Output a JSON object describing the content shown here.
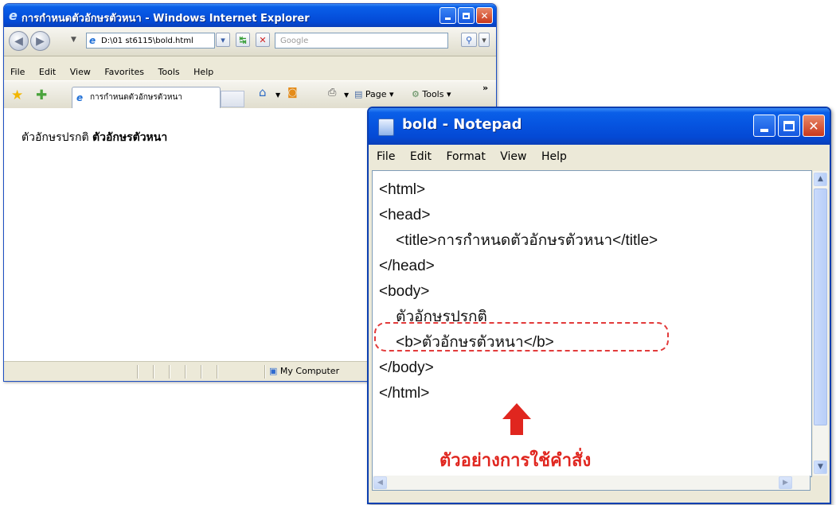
{
  "ie": {
    "title": "การกำหนดตัวอักษรตัวหนา - Windows Internet Explorer",
    "address": "D:\\01 st6115\\bold.html",
    "search_placeholder": "Google",
    "menu": [
      "File",
      "Edit",
      "View",
      "Favorites",
      "Tools",
      "Help"
    ],
    "tab_label": "การกำหนดตัวอักษรตัวหนา",
    "toolbar": {
      "page_label": "Page",
      "tools_label": "Tools"
    },
    "content": {
      "normal_text": "ตัวอักษรปรกติ",
      "bold_text": "ตัวอักษรตัวหนา"
    },
    "status_zone": "My Computer"
  },
  "notepad": {
    "title": "bold - Notepad",
    "menu": [
      "File",
      "Edit",
      "Format",
      "View",
      "Help"
    ],
    "code_lines": [
      "<html>",
      "<head>",
      "    <title>การกำหนดตัวอักษรตัวหนา</title>",
      "</head>",
      "<body>",
      "    ตัวอักษรปรกติ",
      "    <b>ตัวอักษรตัวหนา</b>",
      "</body>",
      "</html>"
    ]
  },
  "annotation": {
    "caption": "ตัวอย่างการใช้คำสั่ง",
    "accent_color": "#e0261f"
  }
}
